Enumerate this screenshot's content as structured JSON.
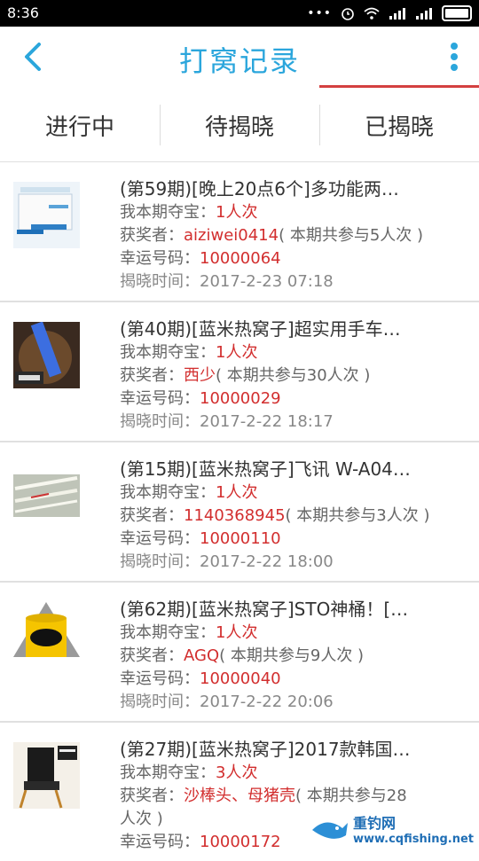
{
  "status": {
    "time": "8:36"
  },
  "header": {
    "title": "打窝记录"
  },
  "tabs": [
    {
      "label": "进行中"
    },
    {
      "label": "待揭晓"
    },
    {
      "label": "已揭晓"
    }
  ],
  "items": [
    {
      "title": "(第59期)[晚上20点6个]多功能两…",
      "my_bid_label": "我本期夺宝：",
      "my_bid": "1人次",
      "winner_label": "获奖者：",
      "winner": "aiziwei0414",
      "participants": "( 本期共参与5人次 )",
      "lucky_label": "幸运号码：",
      "lucky": "10000064",
      "time_label": "揭晓时间：",
      "time": "2017-2-23 07:18"
    },
    {
      "title": "(第40期)[蓝米热窝子]超实用手车…",
      "my_bid_label": "我本期夺宝：",
      "my_bid": "1人次",
      "winner_label": "获奖者：",
      "winner": "西少",
      "participants": "( 本期共参与30人次 )",
      "lucky_label": "幸运号码：",
      "lucky": "10000029",
      "time_label": "揭晓时间：",
      "time": "2017-2-22 18:17"
    },
    {
      "title": "(第15期)[蓝米热窝子]飞讯 W-A04…",
      "my_bid_label": "我本期夺宝：",
      "my_bid": "1人次",
      "winner_label": "获奖者：",
      "winner": "1140368945",
      "participants": "( 本期共参与3人次 )",
      "lucky_label": "幸运号码：",
      "lucky": "10000110",
      "time_label": "揭晓时间：",
      "time": "2017-2-22 18:00"
    },
    {
      "title": "(第62期)[蓝米热窝子]STO神桶！[…",
      "my_bid_label": "我本期夺宝：",
      "my_bid": "1人次",
      "winner_label": "获奖者：",
      "winner": "AGQ",
      "participants": "( 本期共参与9人次 )",
      "lucky_label": "幸运号码：",
      "lucky": "10000040",
      "time_label": "揭晓时间：",
      "time": "2017-2-22 20:06"
    },
    {
      "title": "(第27期)[蓝米热窝子]2017款韩国…",
      "my_bid_label": "我本期夺宝：",
      "my_bid": "3人次",
      "winner_label": "获奖者：",
      "winner": "沙棒头、母猪壳",
      "participants": "( 本期共参与28",
      "participants_2": "人次 )",
      "lucky_label": "幸运号码：",
      "lucky": "10000172"
    }
  ],
  "watermark": {
    "cn": "重钓网",
    "url": "www.cqfishing.net"
  },
  "colors": {
    "accent": "#2ba6dc",
    "highlight": "#d22e2e",
    "indicator": "#d44040"
  }
}
